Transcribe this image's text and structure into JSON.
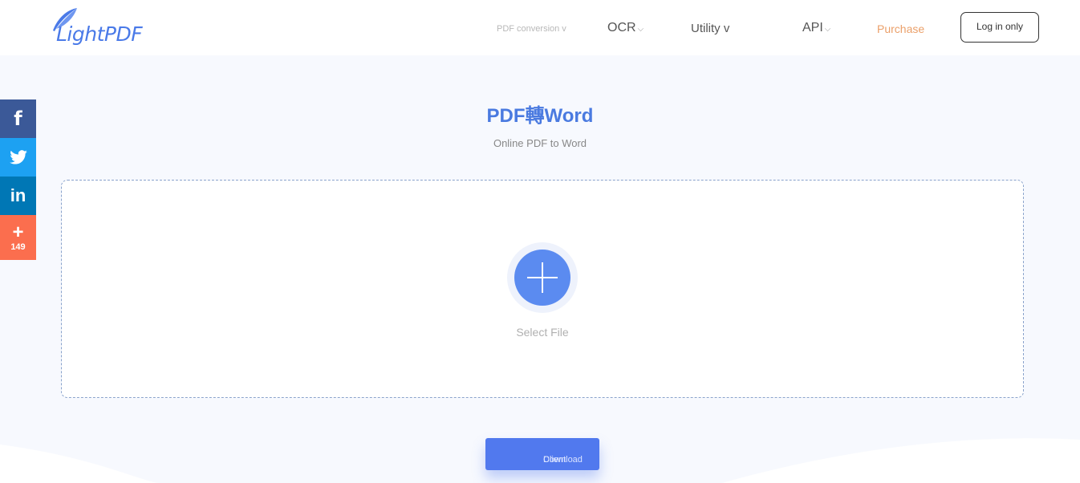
{
  "header": {
    "logo_text": "LightPDF",
    "nav": [
      {
        "label": "PDF conversion v"
      },
      {
        "label": "OCR",
        "chevron": "⌵"
      },
      {
        "label": "Utility v"
      },
      {
        "label": "API",
        "chevron": "⌵"
      },
      {
        "label": "Purchase"
      }
    ],
    "login_label": "Log in only"
  },
  "social": {
    "facebook_glyph": "f",
    "twitter_glyph": "🐦",
    "linkedin_glyph": "in",
    "more_glyph": "+",
    "share_count": "149"
  },
  "main": {
    "title": "PDF轉Word",
    "subtitle": "Online PDF to Word",
    "select_file_label": "Select File",
    "download_label_line1": "Download",
    "download_label_line2": "Client"
  },
  "colors": {
    "accent": "#5b8bf0",
    "title": "#4a7ae0",
    "purchase": "#eba06a",
    "facebook": "#3b5998",
    "twitter": "#1da1f2",
    "linkedin": "#0077b5",
    "share": "#fb6e4e"
  }
}
